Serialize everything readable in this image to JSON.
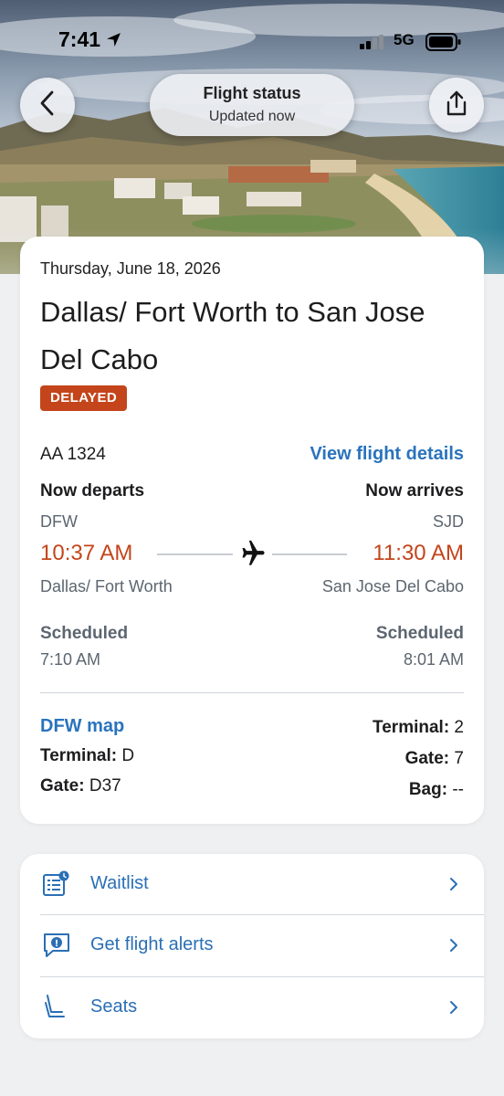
{
  "status_bar": {
    "time": "7:41",
    "network": "5G"
  },
  "header": {
    "title": "Flight status",
    "subtitle": "Updated now"
  },
  "flight": {
    "date": "Thursday, June 18, 2026",
    "route": "Dallas/ Fort Worth to San Jose Del Cabo",
    "status_badge": "DELAYED",
    "flight_number": "AA 1324",
    "details_link": "View flight details",
    "departure": {
      "label": "Now departs",
      "code": "DFW",
      "time": "10:37 AM",
      "city": "Dallas/ Fort Worth",
      "scheduled_label": "Scheduled",
      "scheduled_time": "7:10 AM",
      "map_link": "DFW map",
      "terminal_label": "Terminal:",
      "terminal": "D",
      "gate_label": "Gate:",
      "gate": "D37"
    },
    "arrival": {
      "label": "Now arrives",
      "code": "SJD",
      "time": "11:30 AM",
      "city": "San Jose Del Cabo",
      "scheduled_label": "Scheduled",
      "scheduled_time": "8:01 AM",
      "terminal_label": "Terminal:",
      "terminal": "2",
      "gate_label": "Gate:",
      "gate": "7",
      "bag_label": "Bag:",
      "bag": "--"
    }
  },
  "actions": [
    {
      "label": "Waitlist",
      "icon": "waitlist-icon"
    },
    {
      "label": "Get flight alerts",
      "icon": "flight-alerts-icon"
    },
    {
      "label": "Seats",
      "icon": "seat-icon"
    }
  ],
  "colors": {
    "accent_blue": "#2a73bd",
    "delay_red": "#c4451b",
    "muted_gray": "#5c6670",
    "background": "#eff0f2"
  }
}
